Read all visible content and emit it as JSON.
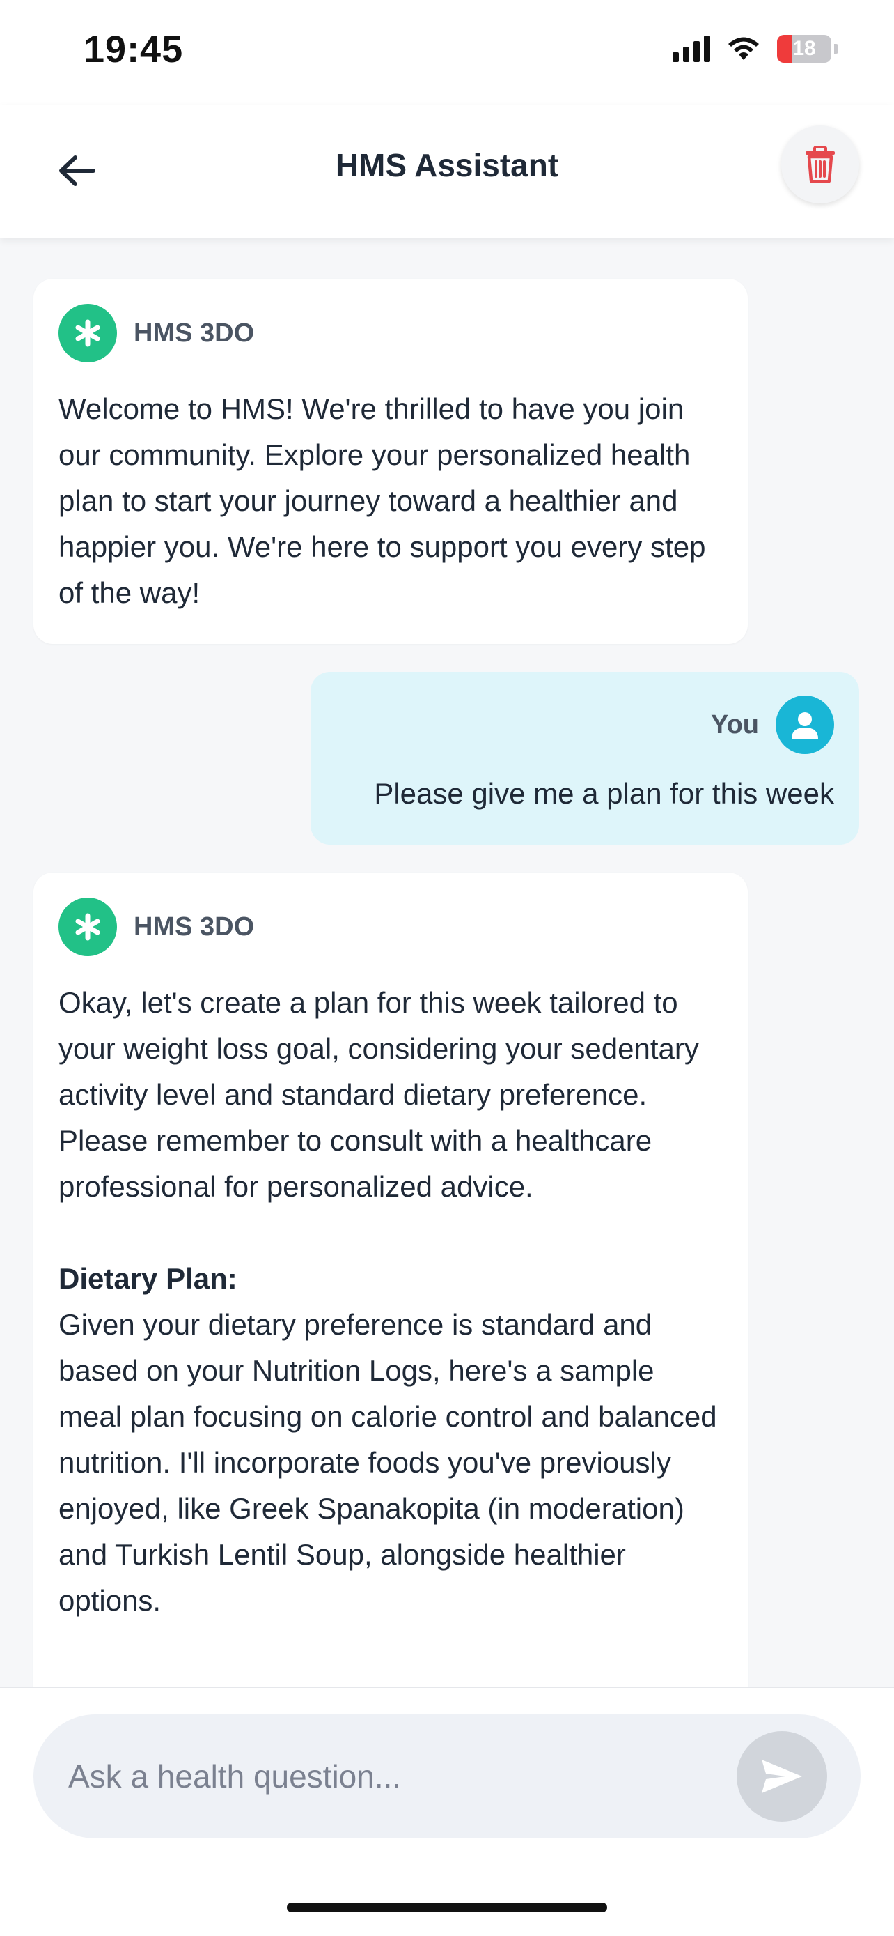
{
  "status_bar": {
    "time": "19:45",
    "battery_level": "18",
    "icons": [
      "signal-icon",
      "wifi-icon",
      "battery-icon"
    ]
  },
  "header": {
    "title": "HMS Assistant",
    "back_icon": "arrow-left-icon",
    "delete_icon": "trash-icon",
    "delete_color": "#e5484d"
  },
  "messages": [
    {
      "sender": "HMS 3DO",
      "role": "assistant",
      "text": "Welcome to HMS! We're thrilled to have you join our community. Explore your personalized health plan to start your journey toward a healthier and happier you. We're here to support you every step of the way!"
    },
    {
      "sender": "You",
      "role": "user",
      "text": "Please give me a plan for this week"
    },
    {
      "sender": "HMS 3DO",
      "role": "assistant",
      "text": "Okay, let's create a plan for this week tailored to your weight loss goal, considering your sedentary activity level and standard dietary preference. Please remember to consult with a healthcare professional for personalized advice.",
      "section_heading": "Dietary Plan:",
      "section_text": "Given your dietary preference is standard and based on your Nutrition Logs, here's a sample meal plan focusing on calorie control and balanced nutrition. I'll incorporate foods you've previously enjoyed, like Greek Spanakopita (in moderation) and Turkish Lentil Soup, alongside healthier options."
    }
  ],
  "composer": {
    "placeholder": "Ask a health question...",
    "value": "",
    "send_icon": "send-icon"
  },
  "colors": {
    "assistant_avatar": "#22c187",
    "user_avatar": "#19b6d6",
    "user_bubble": "#def5fa"
  }
}
